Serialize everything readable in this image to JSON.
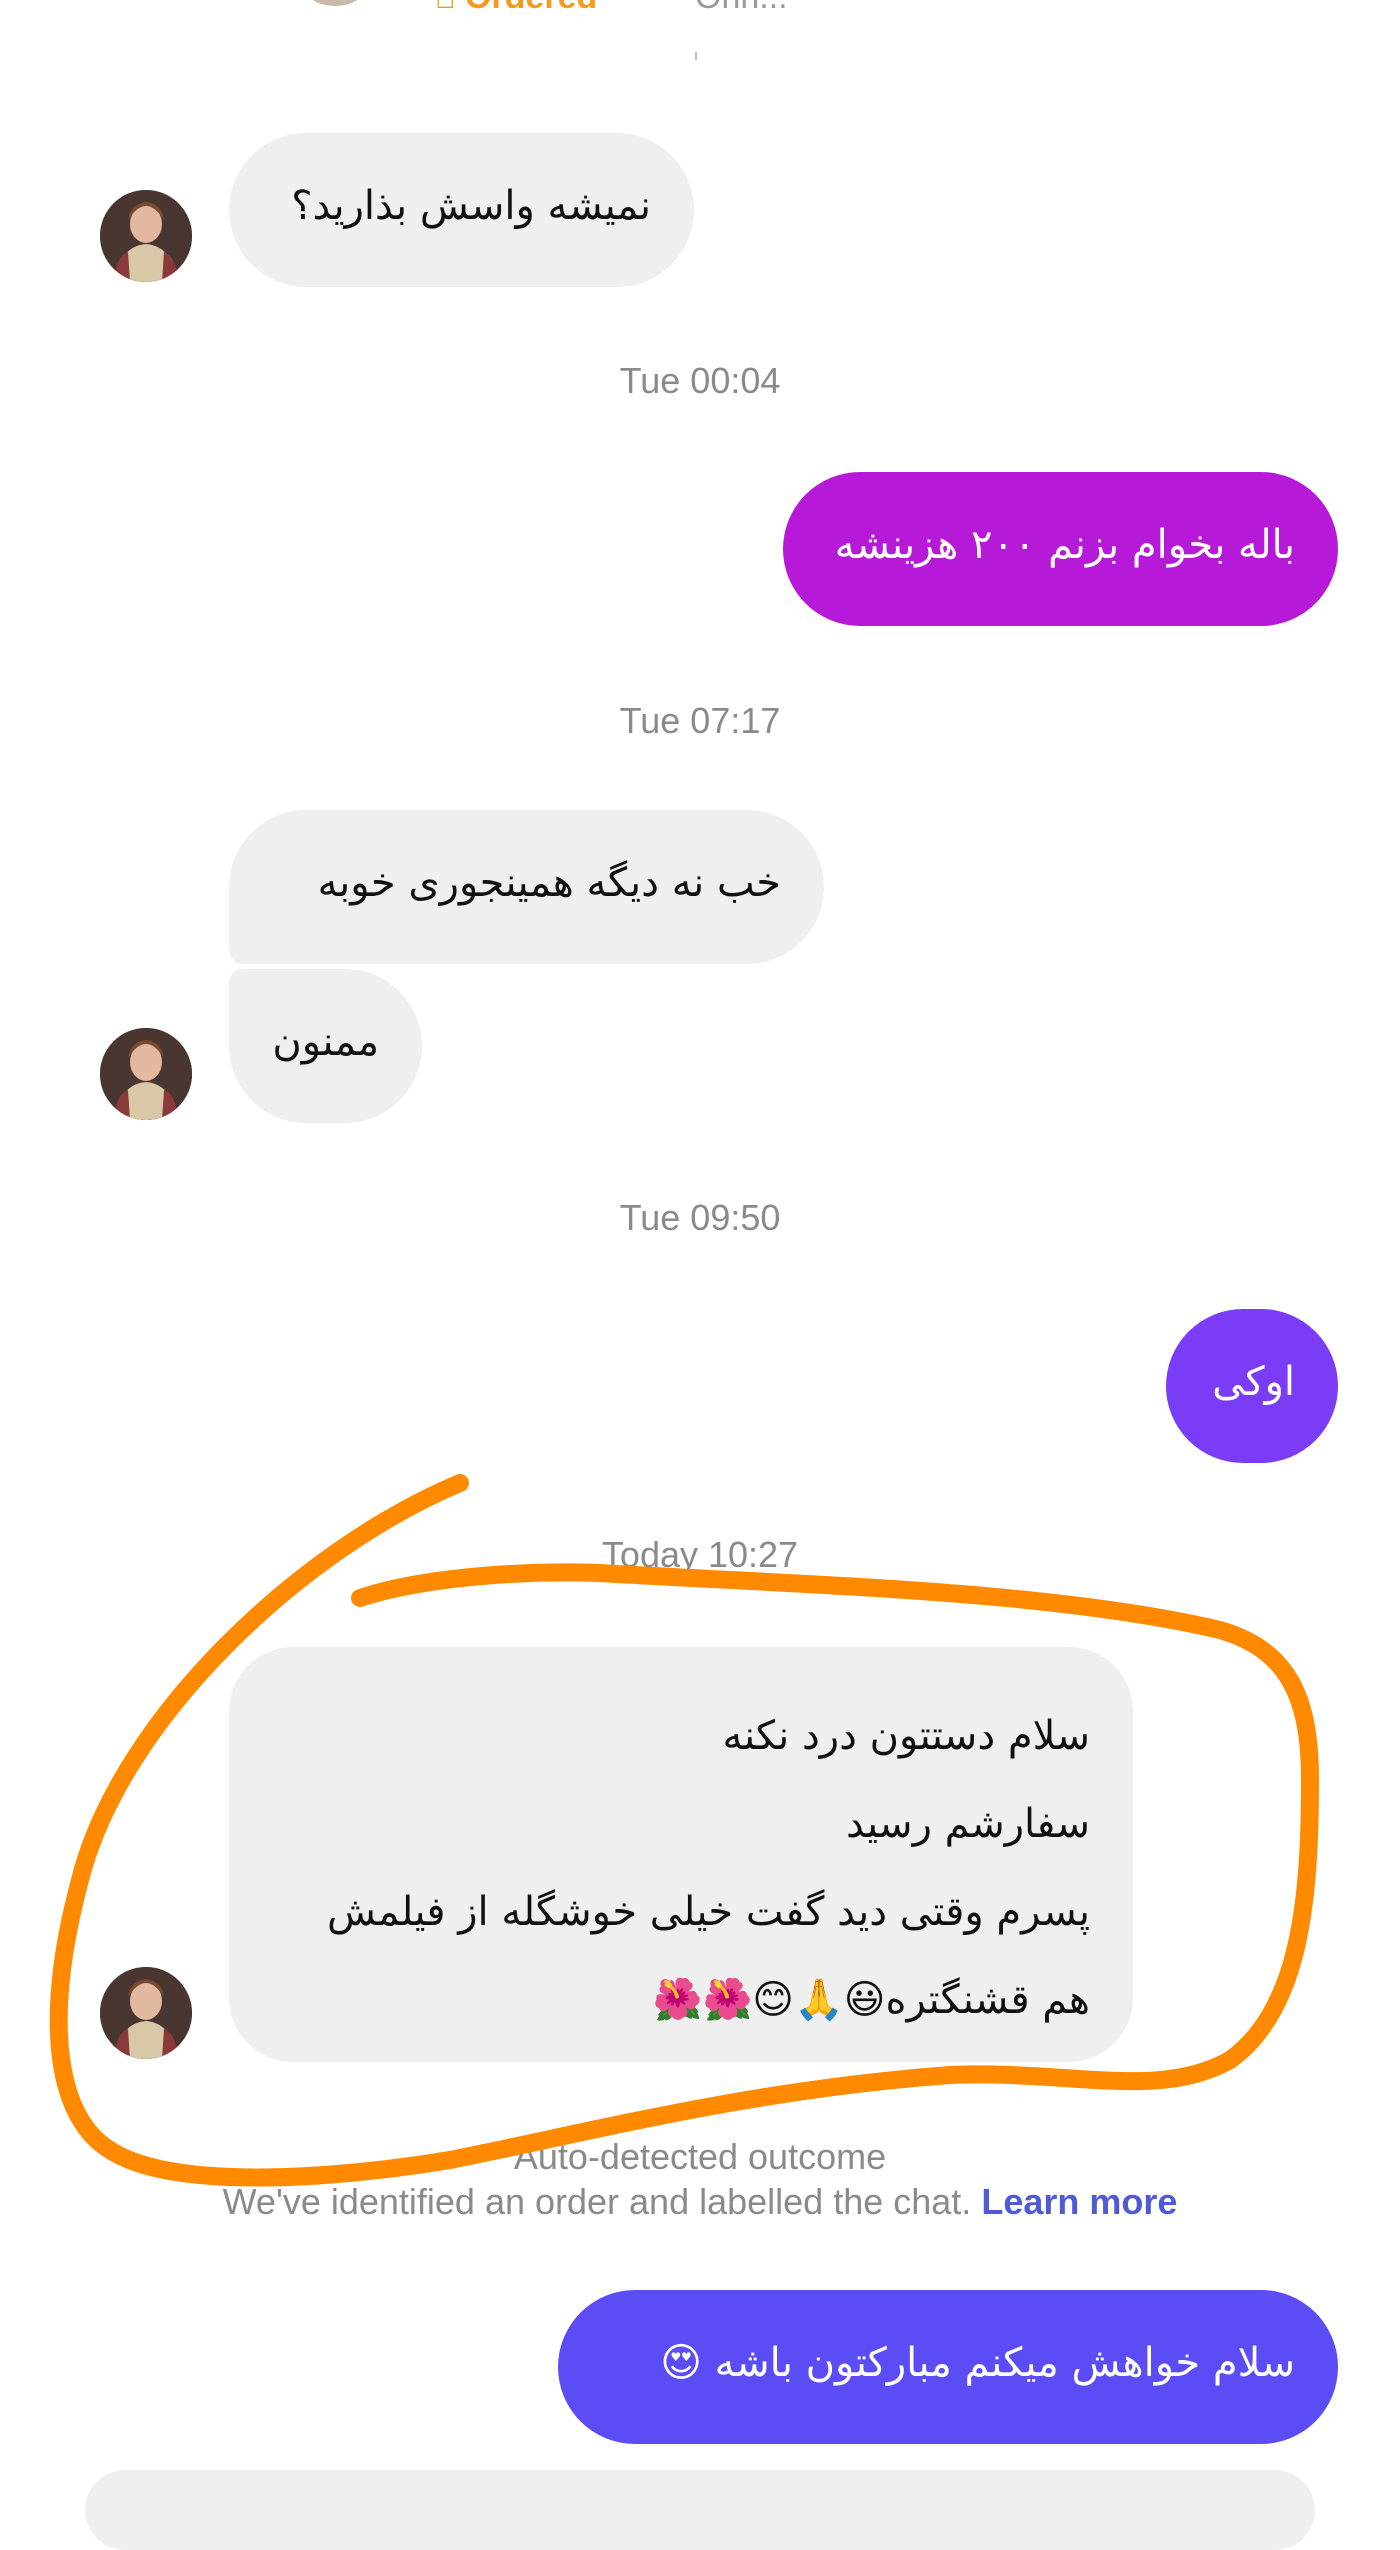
{
  "header": {
    "badge_label": "Ordered",
    "preview_text": "Ohh..."
  },
  "timestamps": [
    "Tue 00:04",
    "Tue 07:17",
    "Tue 09:50",
    "Today 10:27"
  ],
  "messages": [
    {
      "sender": "them",
      "lines": [
        "نمیشه واسش بذارید؟"
      ]
    },
    {
      "sender": "me",
      "lines": [
        "باله بخوام بزنم ۲۰۰ هزینشه"
      ]
    },
    {
      "sender": "them",
      "lines": [
        "خب نه دیگه همینجوری خوبه"
      ]
    },
    {
      "sender": "them",
      "lines": [
        "ممنون"
      ]
    },
    {
      "sender": "me",
      "lines": [
        "اوکی"
      ]
    },
    {
      "sender": "them",
      "lines": [
        "سلام دستتون درد نکنه",
        "سفارشم رسید",
        "پسرم وقتی دید گفت خیلی خوشگله از فیلمش",
        "هم قشنگتره😃🙏😊🌺🌺"
      ]
    },
    {
      "sender": "me",
      "lines": [
        "سلام خواهش میکنم مبارکتون باشه 😍"
      ]
    }
  ],
  "outcome": {
    "title": "Auto-detected outcome",
    "text": "We've identified an order and labelled the chat.",
    "link": "Learn more"
  },
  "colors": {
    "incoming_bubble": "#efefef",
    "outgoing_magenta": "#b61ad8",
    "outgoing_purple": "#7a3cf6",
    "outgoing_blue": "#5b4cf6",
    "annotation": "#ff8a00",
    "badge": "#f59a1c"
  }
}
